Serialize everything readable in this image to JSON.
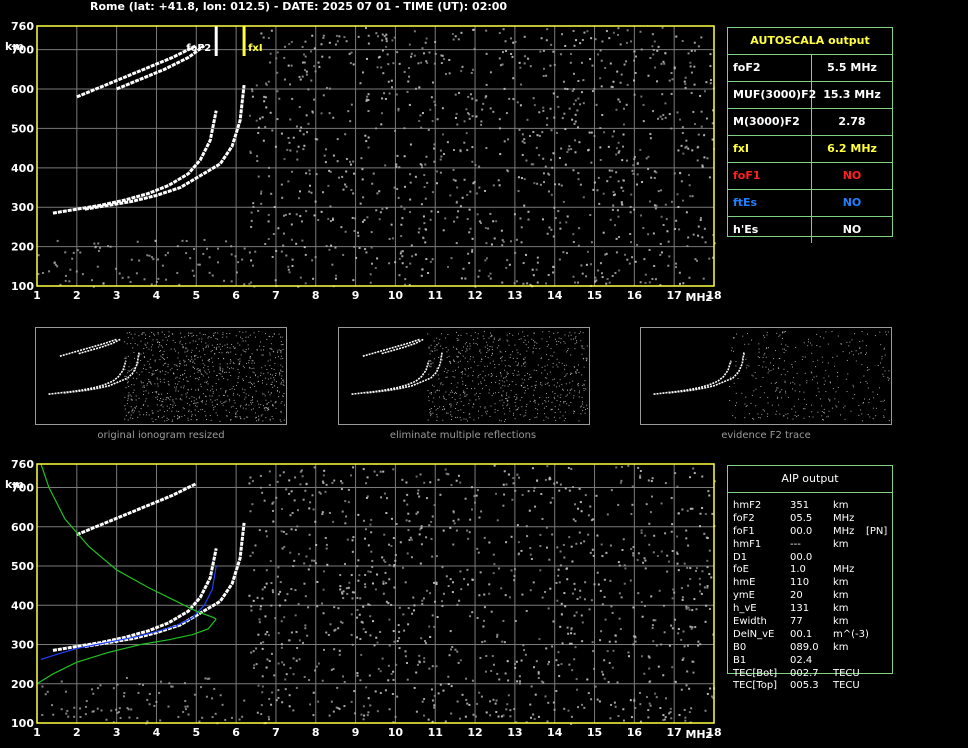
{
  "header": {
    "title": "Rome (lat: +41.8, lon: 012.5) - DATE: 2025 07 01 - TIME (UT): 02:00"
  },
  "chart_data": [
    {
      "type": "scatter",
      "id": "main-ionogram",
      "xlabel": "MHz",
      "ylabel": "km",
      "xlim": [
        1,
        18
      ],
      "ylim": [
        100,
        760
      ],
      "xticks": [
        1,
        2,
        3,
        4,
        5,
        6,
        7,
        8,
        9,
        10,
        11,
        12,
        13,
        14,
        15,
        16,
        17,
        18
      ],
      "yticks": [
        100,
        200,
        300,
        400,
        500,
        600,
        700,
        760
      ],
      "grid": true,
      "markers": [
        {
          "label": "foF2",
          "x": 5.5
        },
        {
          "label": "fxI",
          "x": 6.2
        }
      ],
      "series": [
        {
          "trace": "O",
          "x": [
            1.4,
            2.0,
            2.6,
            3.2,
            3.8,
            4.3,
            4.8,
            5.1,
            5.35,
            5.5
          ],
          "y": [
            285,
            295,
            305,
            318,
            335,
            355,
            385,
            420,
            470,
            545
          ]
        },
        {
          "trace": "X",
          "x": [
            2.2,
            2.8,
            3.4,
            4.0,
            4.6,
            5.1,
            5.6,
            5.9,
            6.1,
            6.2
          ],
          "y": [
            295,
            305,
            315,
            330,
            350,
            380,
            410,
            455,
            520,
            610
          ]
        },
        {
          "trace": "O-2hop",
          "x": [
            2.0,
            2.6,
            3.2,
            3.8,
            4.4,
            5.0
          ],
          "y": [
            580,
            605,
            630,
            655,
            680,
            710
          ]
        },
        {
          "trace": "X-2hop",
          "x": [
            3.0,
            3.6,
            4.2,
            4.8,
            5.2
          ],
          "y": [
            600,
            625,
            650,
            680,
            710
          ]
        }
      ]
    },
    {
      "type": "scatter",
      "id": "aip-ionogram",
      "xlabel": "MHz",
      "ylabel": "km",
      "xlim": [
        1,
        18
      ],
      "ylim": [
        100,
        760
      ],
      "xticks": [
        1,
        2,
        3,
        4,
        5,
        6,
        7,
        8,
        9,
        10,
        11,
        12,
        13,
        14,
        15,
        16,
        17,
        18
      ],
      "yticks": [
        100,
        200,
        300,
        400,
        500,
        600,
        700,
        760
      ],
      "grid": true,
      "series": [
        {
          "trace": "O",
          "x": [
            1.4,
            2.0,
            2.6,
            3.2,
            3.8,
            4.3,
            4.8,
            5.1,
            5.35,
            5.5
          ],
          "y": [
            285,
            295,
            305,
            318,
            335,
            355,
            385,
            420,
            470,
            545
          ]
        },
        {
          "trace": "X",
          "x": [
            2.2,
            2.8,
            3.4,
            4.0,
            4.6,
            5.1,
            5.6,
            5.9,
            6.1,
            6.2
          ],
          "y": [
            295,
            305,
            315,
            330,
            350,
            380,
            410,
            455,
            520,
            610
          ]
        },
        {
          "trace": "O-2hop",
          "x": [
            2.0,
            2.6,
            3.2,
            3.8,
            4.4,
            5.0
          ],
          "y": [
            580,
            605,
            630,
            655,
            680,
            710
          ]
        },
        {
          "trace": "model-O",
          "color": "#2040ff",
          "x": [
            1.1,
            1.5,
            2.0,
            2.5,
            3.0,
            3.5,
            4.0,
            4.5,
            4.9,
            5.2,
            5.4,
            5.5
          ],
          "y": [
            262,
            275,
            290,
            300,
            310,
            320,
            333,
            348,
            368,
            400,
            440,
            500
          ]
        },
        {
          "trace": "profile-upper",
          "color": "#20c020",
          "x": [
            1.1,
            1.3,
            1.7,
            2.3,
            3.0,
            3.8,
            4.5,
            5.0,
            5.4,
            5.5
          ],
          "y": [
            760,
            700,
            620,
            550,
            490,
            445,
            410,
            385,
            370,
            365
          ]
        },
        {
          "trace": "profile-lower",
          "color": "#20c020",
          "x": [
            1.0,
            1.4,
            2.0,
            2.8,
            3.6,
            4.3,
            4.9,
            5.3,
            5.5
          ],
          "y": [
            200,
            225,
            255,
            280,
            300,
            312,
            325,
            340,
            365
          ]
        }
      ]
    }
  ],
  "thumbnails": [
    {
      "caption": "original ionogram resized"
    },
    {
      "caption": "eliminate multiple reflections"
    },
    {
      "caption": "evidence F2 trace"
    }
  ],
  "autoscala": {
    "title": "AUTOSCALA output",
    "rows": [
      {
        "label": "foF2",
        "value": "5.5 MHz",
        "color": "#ffffff"
      },
      {
        "label": "MUF(3000)F2",
        "value": "15.3 MHz",
        "color": "#ffffff"
      },
      {
        "label": "M(3000)F2",
        "value": "2.78",
        "color": "#ffffff"
      },
      {
        "label": "fxI",
        "value": "6.2 MHz",
        "color": "#ffff40"
      },
      {
        "label": "foF1",
        "value": "NO",
        "color": "#ff2020"
      },
      {
        "label": "ftEs",
        "value": "NO",
        "color": "#2080ff"
      },
      {
        "label": "h'Es",
        "value": "NO",
        "color": "#ffffff"
      }
    ]
  },
  "aip": {
    "title": "AIP output",
    "rows": [
      {
        "name": "hmF2",
        "value": "351",
        "unit": "km",
        "extra": ""
      },
      {
        "name": "foF2",
        "value": "05.5",
        "unit": "MHz",
        "extra": ""
      },
      {
        "name": "foF1",
        "value": "00.0",
        "unit": "MHz",
        "extra": "[PN]"
      },
      {
        "name": "hmF1",
        "value": "---",
        "unit": "km",
        "extra": ""
      },
      {
        "name": "D1",
        "value": "00.0",
        "unit": "",
        "extra": ""
      },
      {
        "name": "foE",
        "value": "1.0",
        "unit": "MHz",
        "extra": ""
      },
      {
        "name": "hmE",
        "value": "110",
        "unit": "km",
        "extra": ""
      },
      {
        "name": "ymE",
        "value": "20",
        "unit": "km",
        "extra": ""
      },
      {
        "name": "h_vE",
        "value": "131",
        "unit": "km",
        "extra": ""
      },
      {
        "name": "Ewidth",
        "value": "77",
        "unit": "km",
        "extra": ""
      },
      {
        "name": "DelN_vE",
        "value": "00.1",
        "unit": "m^(-3)",
        "extra": ""
      },
      {
        "name": "B0",
        "value": "089.0",
        "unit": "km",
        "extra": ""
      },
      {
        "name": "B1",
        "value": "02.4",
        "unit": "",
        "extra": ""
      },
      {
        "name": "TEC[Bot]",
        "value": "002.7",
        "unit": "TECU",
        "extra": ""
      },
      {
        "name": "TEC[Top]",
        "value": "005.3",
        "unit": "TECU",
        "extra": ""
      }
    ]
  },
  "colors": {
    "axis": "#ffff40",
    "grid": "#7a7a7a",
    "trace": "#ffffff",
    "noise": "#bdbdbd",
    "panel_border": "#7fd27f"
  }
}
